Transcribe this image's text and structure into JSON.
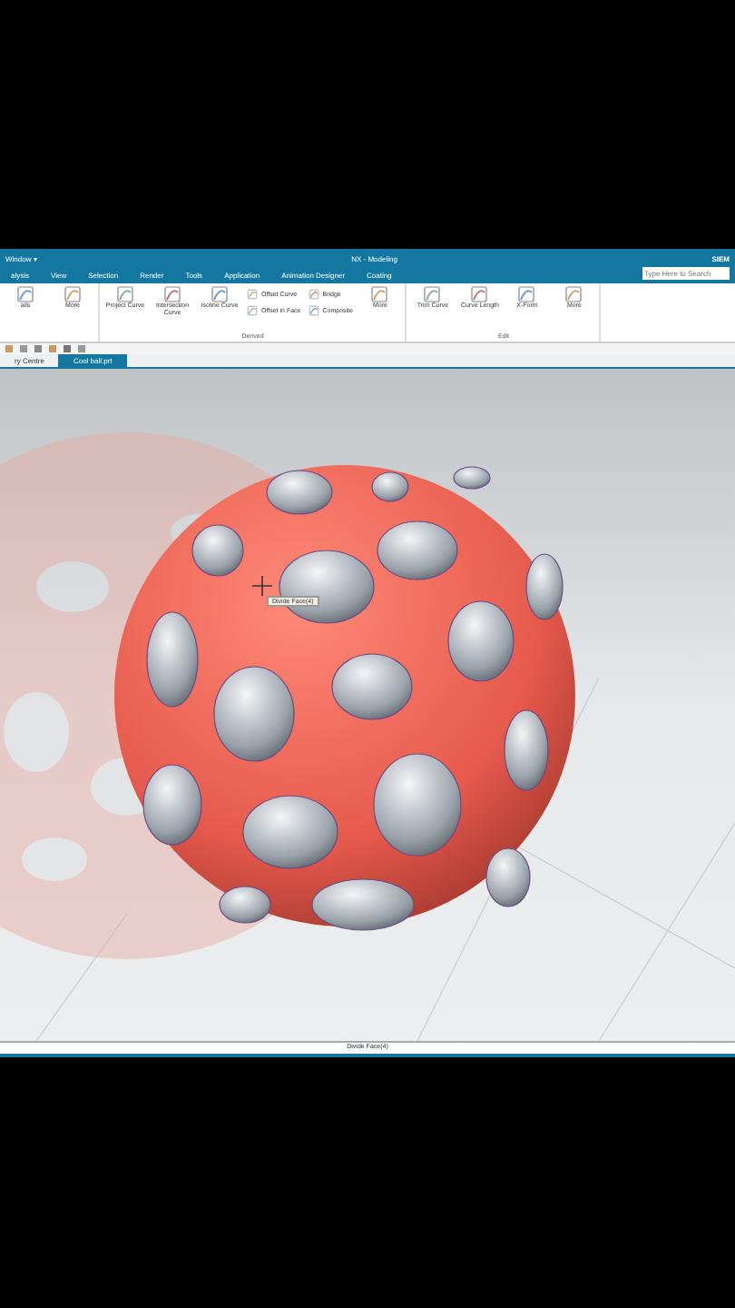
{
  "title_bar": {
    "menu": "Window ▾",
    "title": "NX - Modeling",
    "brand": "SIEM",
    "search": {
      "placeholder": "Type Here to Search"
    }
  },
  "menu_tabs": [
    {
      "label": "alysis",
      "selected": false
    },
    {
      "label": "View",
      "selected": false
    },
    {
      "label": "Selection",
      "selected": false
    },
    {
      "label": "Render",
      "selected": false
    },
    {
      "label": "Tools",
      "selected": false
    },
    {
      "label": "Application",
      "selected": false
    },
    {
      "label": "Animation Designer",
      "selected": false
    },
    {
      "label": "Coating",
      "selected": false
    }
  ],
  "ribbon": {
    "groups": [
      {
        "items": [
          {
            "kind": "large",
            "label": "ails"
          },
          {
            "kind": "large",
            "label": "More"
          }
        ]
      },
      {
        "label": "Derived",
        "items": [
          {
            "kind": "large",
            "label": "Project Curve"
          },
          {
            "kind": "large",
            "label": "Intersection Curve"
          },
          {
            "kind": "large",
            "label": "Isoline Curve"
          },
          {
            "kind": "small",
            "label": "Offset Curve"
          },
          {
            "kind": "small",
            "label": "Offset in Face"
          },
          {
            "kind": "small",
            "label": "Bridge"
          },
          {
            "kind": "small",
            "label": "Composite"
          },
          {
            "kind": "large",
            "label": "More"
          }
        ]
      },
      {
        "label": "Edit",
        "items": [
          {
            "kind": "large",
            "label": "Trim Curve"
          },
          {
            "kind": "large",
            "label": "Curve Length"
          },
          {
            "kind": "large",
            "label": "X-Form"
          },
          {
            "kind": "large",
            "label": "More"
          }
        ]
      }
    ]
  },
  "doc_tabs": [
    {
      "label": "ry Centre",
      "selected": false
    },
    {
      "label": "Cool ball.prt",
      "selected": true
    }
  ],
  "tooltip": "Divide Face(4)",
  "status_bar": "Divide Face(4)"
}
